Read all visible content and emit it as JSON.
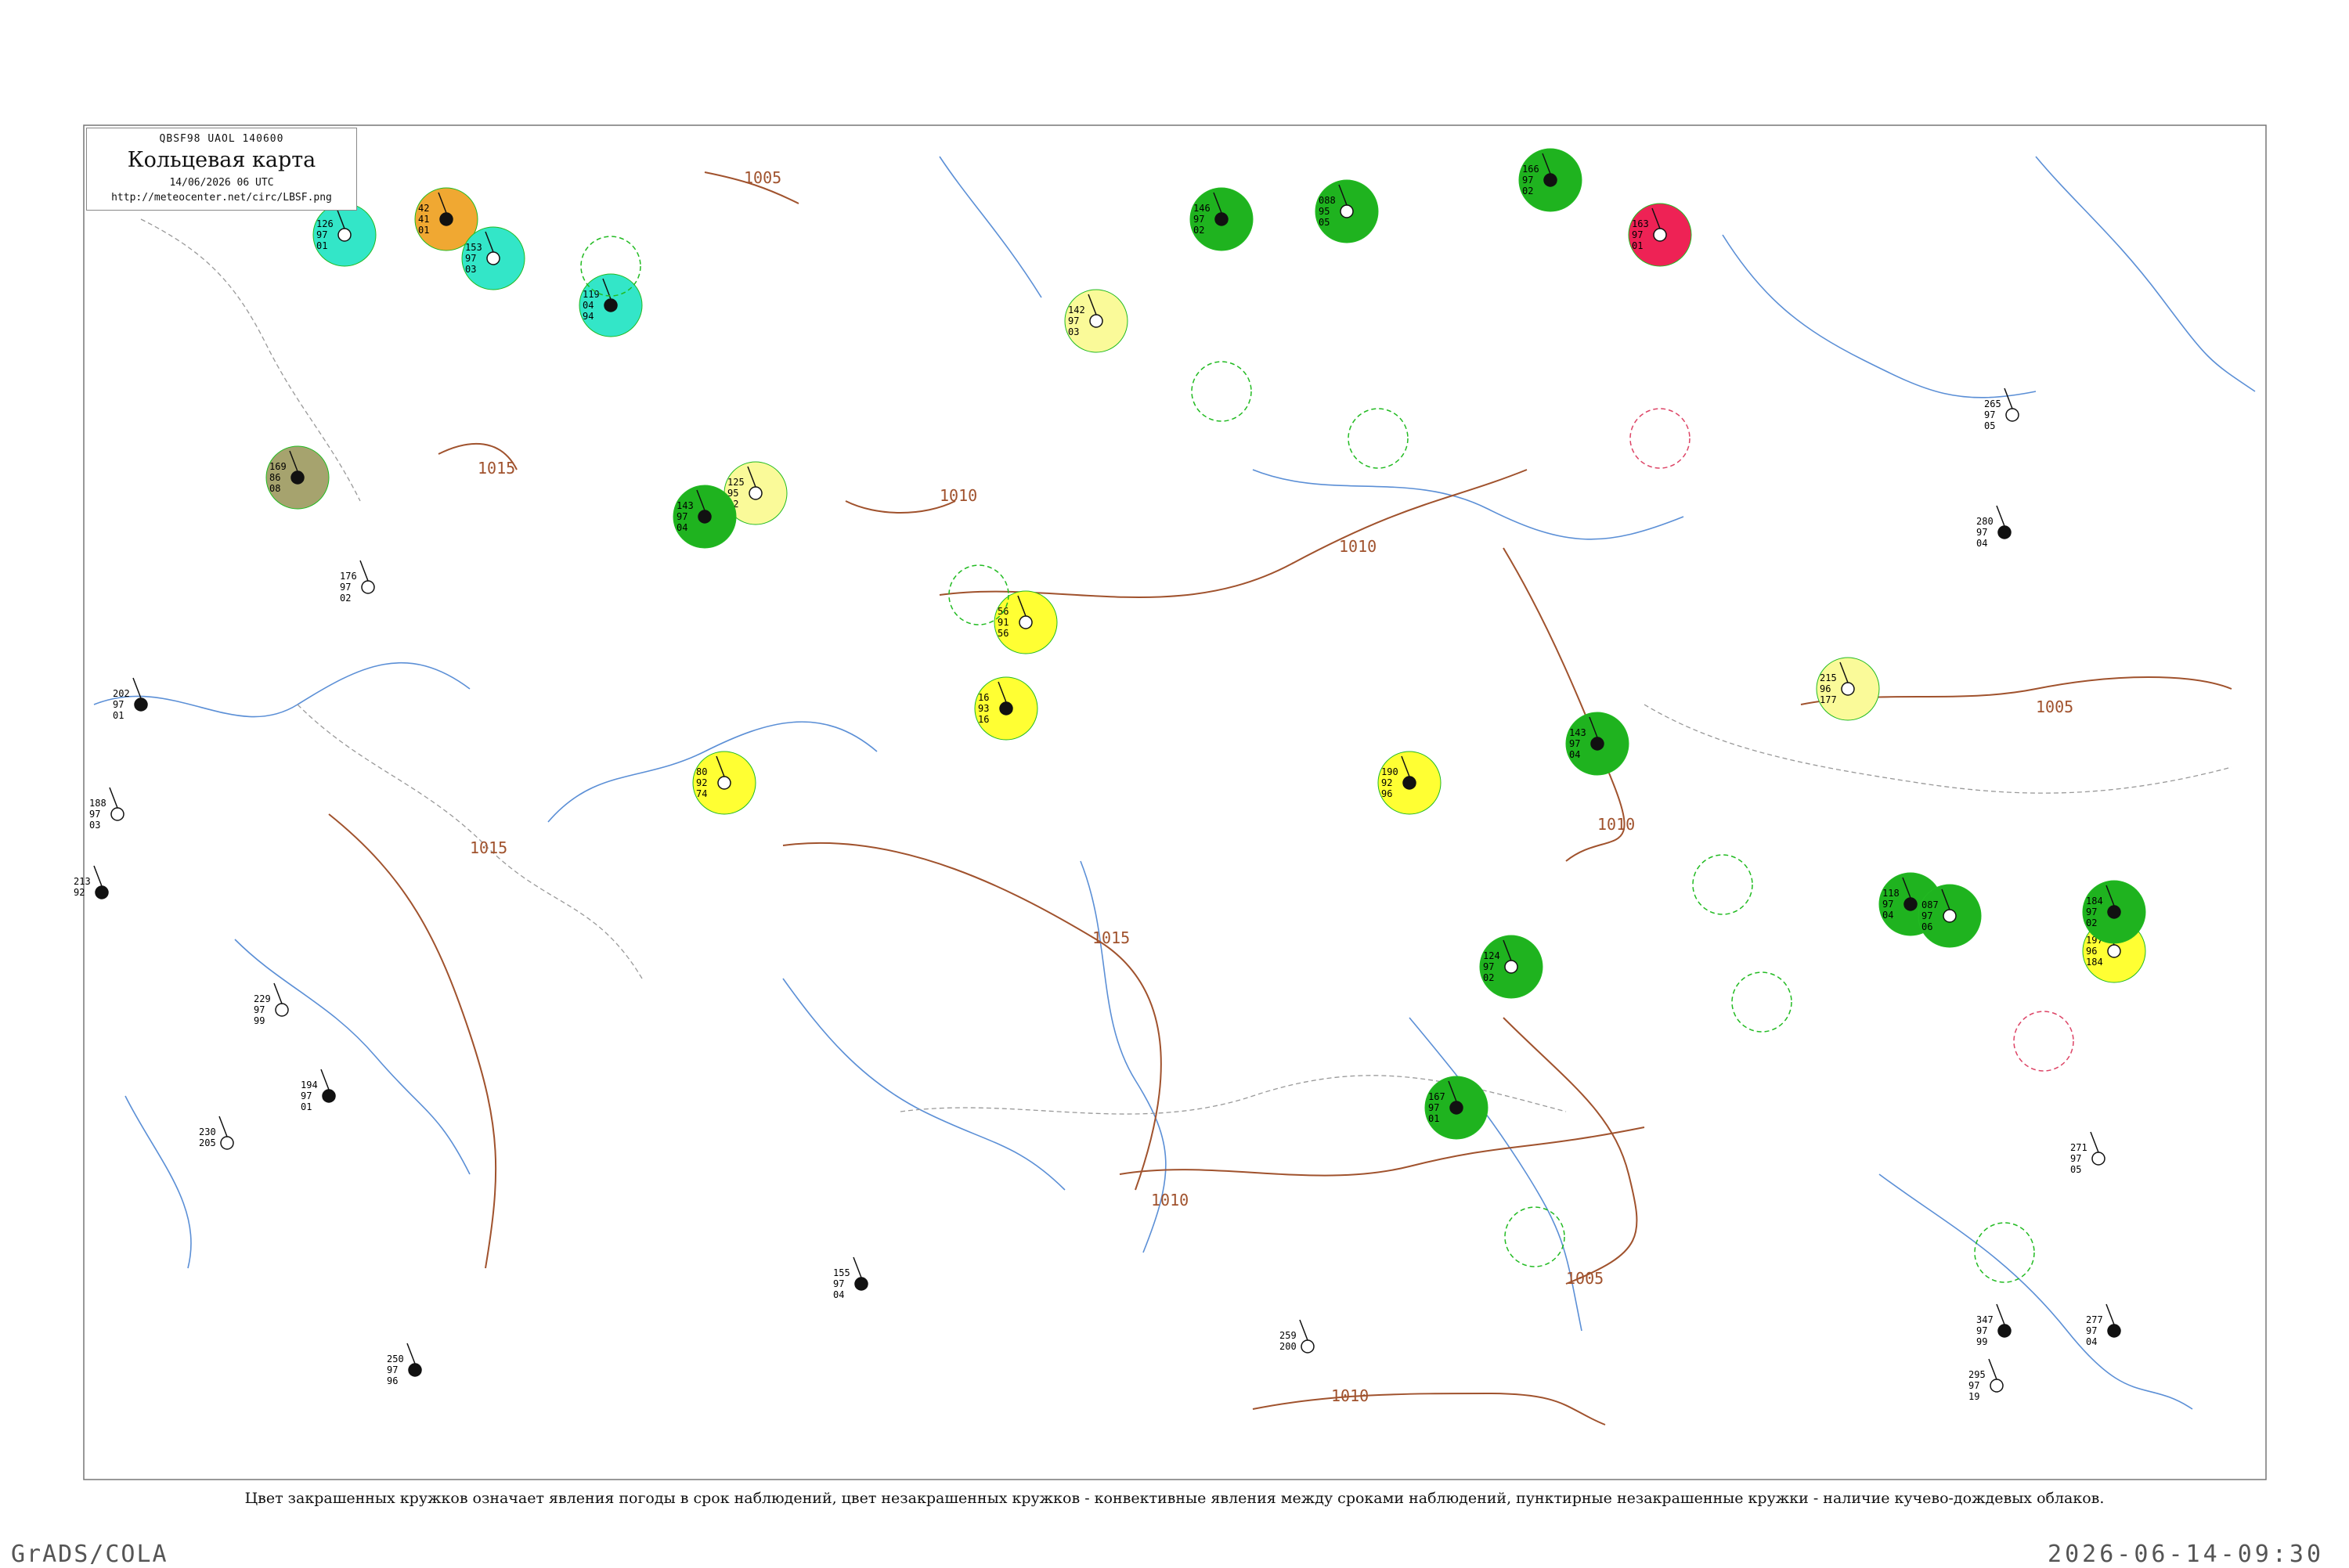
{
  "header": {
    "line1": "QBSF98  UAOL  140600",
    "title": "Кольцевая карта",
    "date": "14/06/2026 06 UTC",
    "url": "http://meteocenter.net/circ/LBSF.png"
  },
  "caption": "Цвет закрашенных кружков означает явления погоды в срок наблюдений, цвет незакрашенных кружков - конвективные явления между сроками наблюдений, пунктирные незакрашенные кружки - наличие кучево-дождевых облаков.",
  "footer": {
    "left": "GrADS/COLA",
    "right": "2026-06-14-09:30"
  },
  "isobar_labels": [
    "1005",
    "1010",
    "1015"
  ],
  "colors": {
    "isobar": "#a0522d",
    "river": "#5b8fd6",
    "border": "#999999",
    "filled_green": "#1fb31f",
    "filled_cyan": "#33e6c8",
    "filled_orange": "#f0a832",
    "filled_yellow": "#ffff33",
    "filled_pale_yellow": "#fafa99",
    "filled_red": "#ee2255",
    "filled_olive": "#a6a36e",
    "ring_green": "#22bb22",
    "ring_red": "#dd4466"
  },
  "stations": [
    {
      "p": "126",
      "t": "97",
      "d": "01",
      "fill": "cyan"
    },
    {
      "p": "42",
      "t": "41",
      "d": "01",
      "fill": "orange"
    },
    {
      "p": "153",
      "t": "97",
      "d": "03",
      "fill": "cyan"
    },
    {
      "p": "119",
      "t": "04",
      "d": "94",
      "fill": "cyan"
    },
    {
      "p": "142",
      "t": "97",
      "d": "03",
      "fill": "pale-yellow"
    },
    {
      "p": "146",
      "t": "97",
      "d": "02",
      "fill": "green"
    },
    {
      "p": "088",
      "t": "95",
      "d": "05",
      "fill": "green"
    },
    {
      "p": "166",
      "t": "97",
      "d": "02",
      "fill": "green"
    },
    {
      "p": "163",
      "t": "97",
      "d": "01",
      "fill": "red"
    },
    {
      "p": "169",
      "t": "86",
      "d": "08",
      "fill": "olive"
    },
    {
      "p": "125",
      "t": "95",
      "d": "02",
      "fill": "pale-yellow"
    },
    {
      "p": "143",
      "t": "97",
      "d": "04",
      "fill": "green"
    },
    {
      "p": "56",
      "t": "91",
      "d": "56",
      "fill": "yellow"
    },
    {
      "p": "16",
      "t": "93",
      "d": "16",
      "fill": "yellow"
    },
    {
      "p": "80",
      "t": "92",
      "d": "74",
      "fill": "yellow"
    },
    {
      "p": "190",
      "t": "92",
      "d": "96",
      "fill": "yellow"
    },
    {
      "p": "215",
      "t": "96",
      "d": "177",
      "fill": "pale-yellow"
    },
    {
      "p": "143",
      "t": "97",
      "d": "04",
      "fill": "green"
    },
    {
      "p": "197",
      "t": "96",
      "d": "184",
      "fill": "yellow"
    },
    {
      "p": "118",
      "t": "97",
      "d": "04",
      "fill": "green"
    },
    {
      "p": "087",
      "t": "97",
      "d": "06",
      "fill": "green"
    },
    {
      "p": "184",
      "t": "97",
      "d": "02",
      "fill": "green"
    },
    {
      "p": "124",
      "t": "97",
      "d": "02",
      "fill": "green"
    },
    {
      "p": "167",
      "t": "97",
      "d": "01",
      "fill": "green"
    },
    {
      "p": "188",
      "t": "97",
      "d": "03",
      "fill": "none"
    },
    {
      "p": "213",
      "t": "92",
      "d": "",
      "fill": "none"
    },
    {
      "p": "229",
      "t": "97",
      "d": "99",
      "fill": "none"
    },
    {
      "p": "250",
      "t": "97",
      "d": "96",
      "fill": "none"
    },
    {
      "p": "259",
      "t": "200",
      "d": "",
      "fill": "none"
    },
    {
      "p": "347",
      "t": "97",
      "d": "99",
      "fill": "none"
    },
    {
      "p": "295",
      "t": "97",
      "d": "19",
      "fill": "none"
    },
    {
      "p": "280",
      "t": "97",
      "d": "04",
      "fill": "none"
    },
    {
      "p": "265",
      "t": "97",
      "d": "05",
      "fill": "none"
    },
    {
      "p": "202",
      "t": "97",
      "d": "01",
      "fill": "none"
    },
    {
      "p": "176",
      "t": "97",
      "d": "02",
      "fill": "none"
    },
    {
      "p": "194",
      "t": "97",
      "d": "01",
      "fill": "none"
    },
    {
      "p": "230",
      "t": "205",
      "d": "",
      "fill": "none"
    },
    {
      "p": "155",
      "t": "97",
      "d": "04",
      "fill": "none"
    },
    {
      "p": "271",
      "t": "97",
      "d": "05",
      "fill": "none"
    },
    {
      "p": "277",
      "t": "97",
      "d": "04",
      "fill": "none"
    }
  ]
}
